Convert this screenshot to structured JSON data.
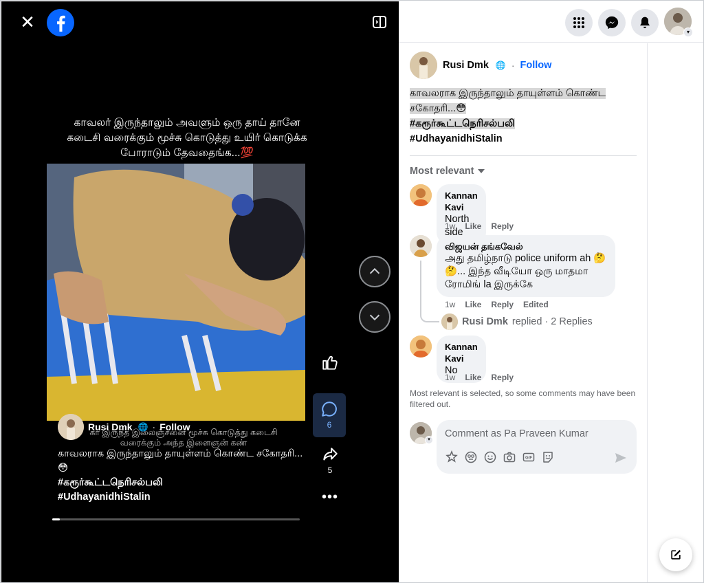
{
  "viewer": {
    "caption": "காவலர் இருந்தாலும் அவளும் ஒரு தாய் தானே கடைசி வரைக்கும் மூச்சு கொடுத்து உயிர் கொடுக்க போராடும் தேவதைங்க...💯",
    "overlay_text": "கா இருந்த இலைஞ்சனை மூச்சு கொடுத்து கடைசி வரைக்கும் அந்த இளைஞன் கண்",
    "progress_fraction": 0.03
  },
  "post": {
    "author": "Rusi Dmk",
    "follow_label": "Follow",
    "dot": "·",
    "text_line": "காவலராக இருந்தாலும் தாயுள்ளம் கொண்ட சகோதரி...😳",
    "hashtag1": "#கரூர்கூட்டநெரிசல்பலி",
    "hashtag2": "#UdhayanidhiStalin"
  },
  "actions": {
    "comment_count": "6",
    "share_count": "5",
    "more": "•••"
  },
  "comments_panel": {
    "sort_label": "Most relevant",
    "comments": [
      {
        "author": "Kannan Kavi",
        "body": "North side",
        "time": "1w",
        "like": "Like",
        "reply": "Reply"
      },
      {
        "author": "விஜயன் தங்கவேல்",
        "body": "அது தமிழ்நாடு police uniform ah 🤔🤔... இந்த வீடியோ ஒரு மாதமா ரோமிங் la இருக்கே",
        "time": "1w",
        "like": "Like",
        "reply": "Reply",
        "edited": "Edited"
      },
      {
        "author": "Kannan Kavi",
        "body": "No",
        "time": "1w",
        "like": "Like",
        "reply": "Reply"
      }
    ],
    "replied": {
      "name": "Rusi Dmk",
      "text": "replied · 2 Replies"
    },
    "notice": "Most relevant is selected, so some comments may have been filtered out.",
    "composer_placeholder": "Comment as Pa Praveen Kumar"
  },
  "colors": {
    "accent": "#0866ff",
    "viewer_bg": "#000000",
    "bubble_bg": "#f0f2f5",
    "secondary_text": "#65676b"
  },
  "icons": {
    "close": "close-icon",
    "logo": "facebook-logo-icon",
    "menu": "grid-menu-icon",
    "messenger": "messenger-icon",
    "notifications": "bell-icon",
    "compose": "new-message-icon"
  }
}
